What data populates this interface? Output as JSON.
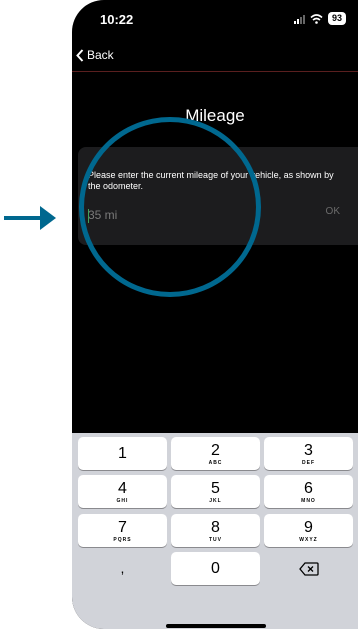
{
  "status_bar": {
    "time": "10:22",
    "battery": "93"
  },
  "nav": {
    "back_label": "Back"
  },
  "screen": {
    "title": "Mileage"
  },
  "dialog": {
    "message": "Please enter the current mileage of your vehicle, as shown by the odometer.",
    "input_placeholder": "35 mi",
    "ok_label": "OK"
  },
  "keypad": {
    "keys": [
      {
        "digit": "1",
        "letters": ""
      },
      {
        "digit": "2",
        "letters": "ABC"
      },
      {
        "digit": "3",
        "letters": "DEF"
      },
      {
        "digit": "4",
        "letters": "GHI"
      },
      {
        "digit": "5",
        "letters": "JKL"
      },
      {
        "digit": "6",
        "letters": "MNO"
      },
      {
        "digit": "7",
        "letters": "PQRS"
      },
      {
        "digit": "8",
        "letters": "TUV"
      },
      {
        "digit": "9",
        "letters": "WXYZ"
      }
    ],
    "comma_label": ",",
    "zero_label": "0"
  },
  "colors": {
    "background": "#000000",
    "highlight_circle": "#00688f",
    "arrow": "#00688f",
    "keyboard_bg": "#d1d3d9"
  }
}
